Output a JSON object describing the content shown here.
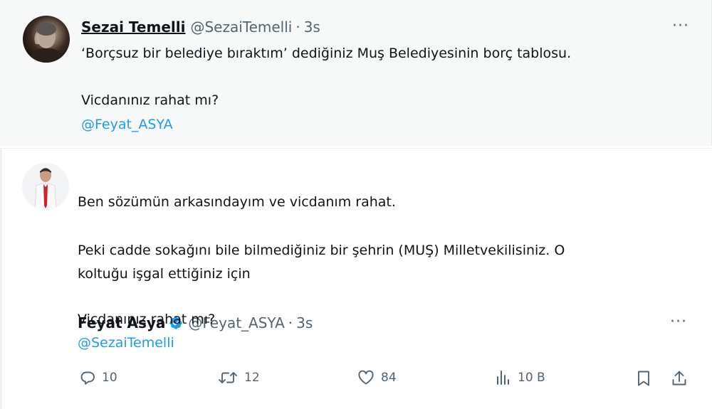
{
  "tweet1": {
    "name": "Sezai Temelli",
    "handle": "@SezaiTemelli",
    "separator": "·",
    "time": "3s",
    "more": "···",
    "line1": "‘Borçsuz bir belediye bıraktım’ dediğiniz Muş Belediyesinin borç tablosu.",
    "line2": "Vicdanınız rahat mı?",
    "mention": "@Feyat_ASYA"
  },
  "tweet2": {
    "name": "Feyat Asya",
    "handle": "@Feyat_ASYA",
    "separator": "·",
    "time": "3s",
    "more": "···",
    "line1": "Ben sözümün arkasındayım ve vicdanım rahat.",
    "line2": "Peki cadde sokağını bile bilmediğiniz bir şehrin (MUŞ) Milletvekilisiniz. O",
    "line3": "koltuğu işgal ettiğiniz için",
    "line4": "Vicdanınız rahat mı?",
    "mention": "@SezaiTemelli"
  },
  "actions": {
    "reply_count": "10",
    "retweet_count": "12",
    "like_count": "84",
    "views_count": "10 B"
  },
  "icons": {
    "reply": "reply-icon",
    "retweet": "retweet-icon",
    "like": "heart-icon",
    "views": "views-icon",
    "bookmark": "bookmark-icon",
    "share": "share-icon",
    "verified": "verified-badge-icon"
  },
  "colors": {
    "link": "#1d9bf0",
    "secondary_text": "#536471",
    "primary_text": "#0f1419",
    "verified": "#1d9bf0"
  }
}
